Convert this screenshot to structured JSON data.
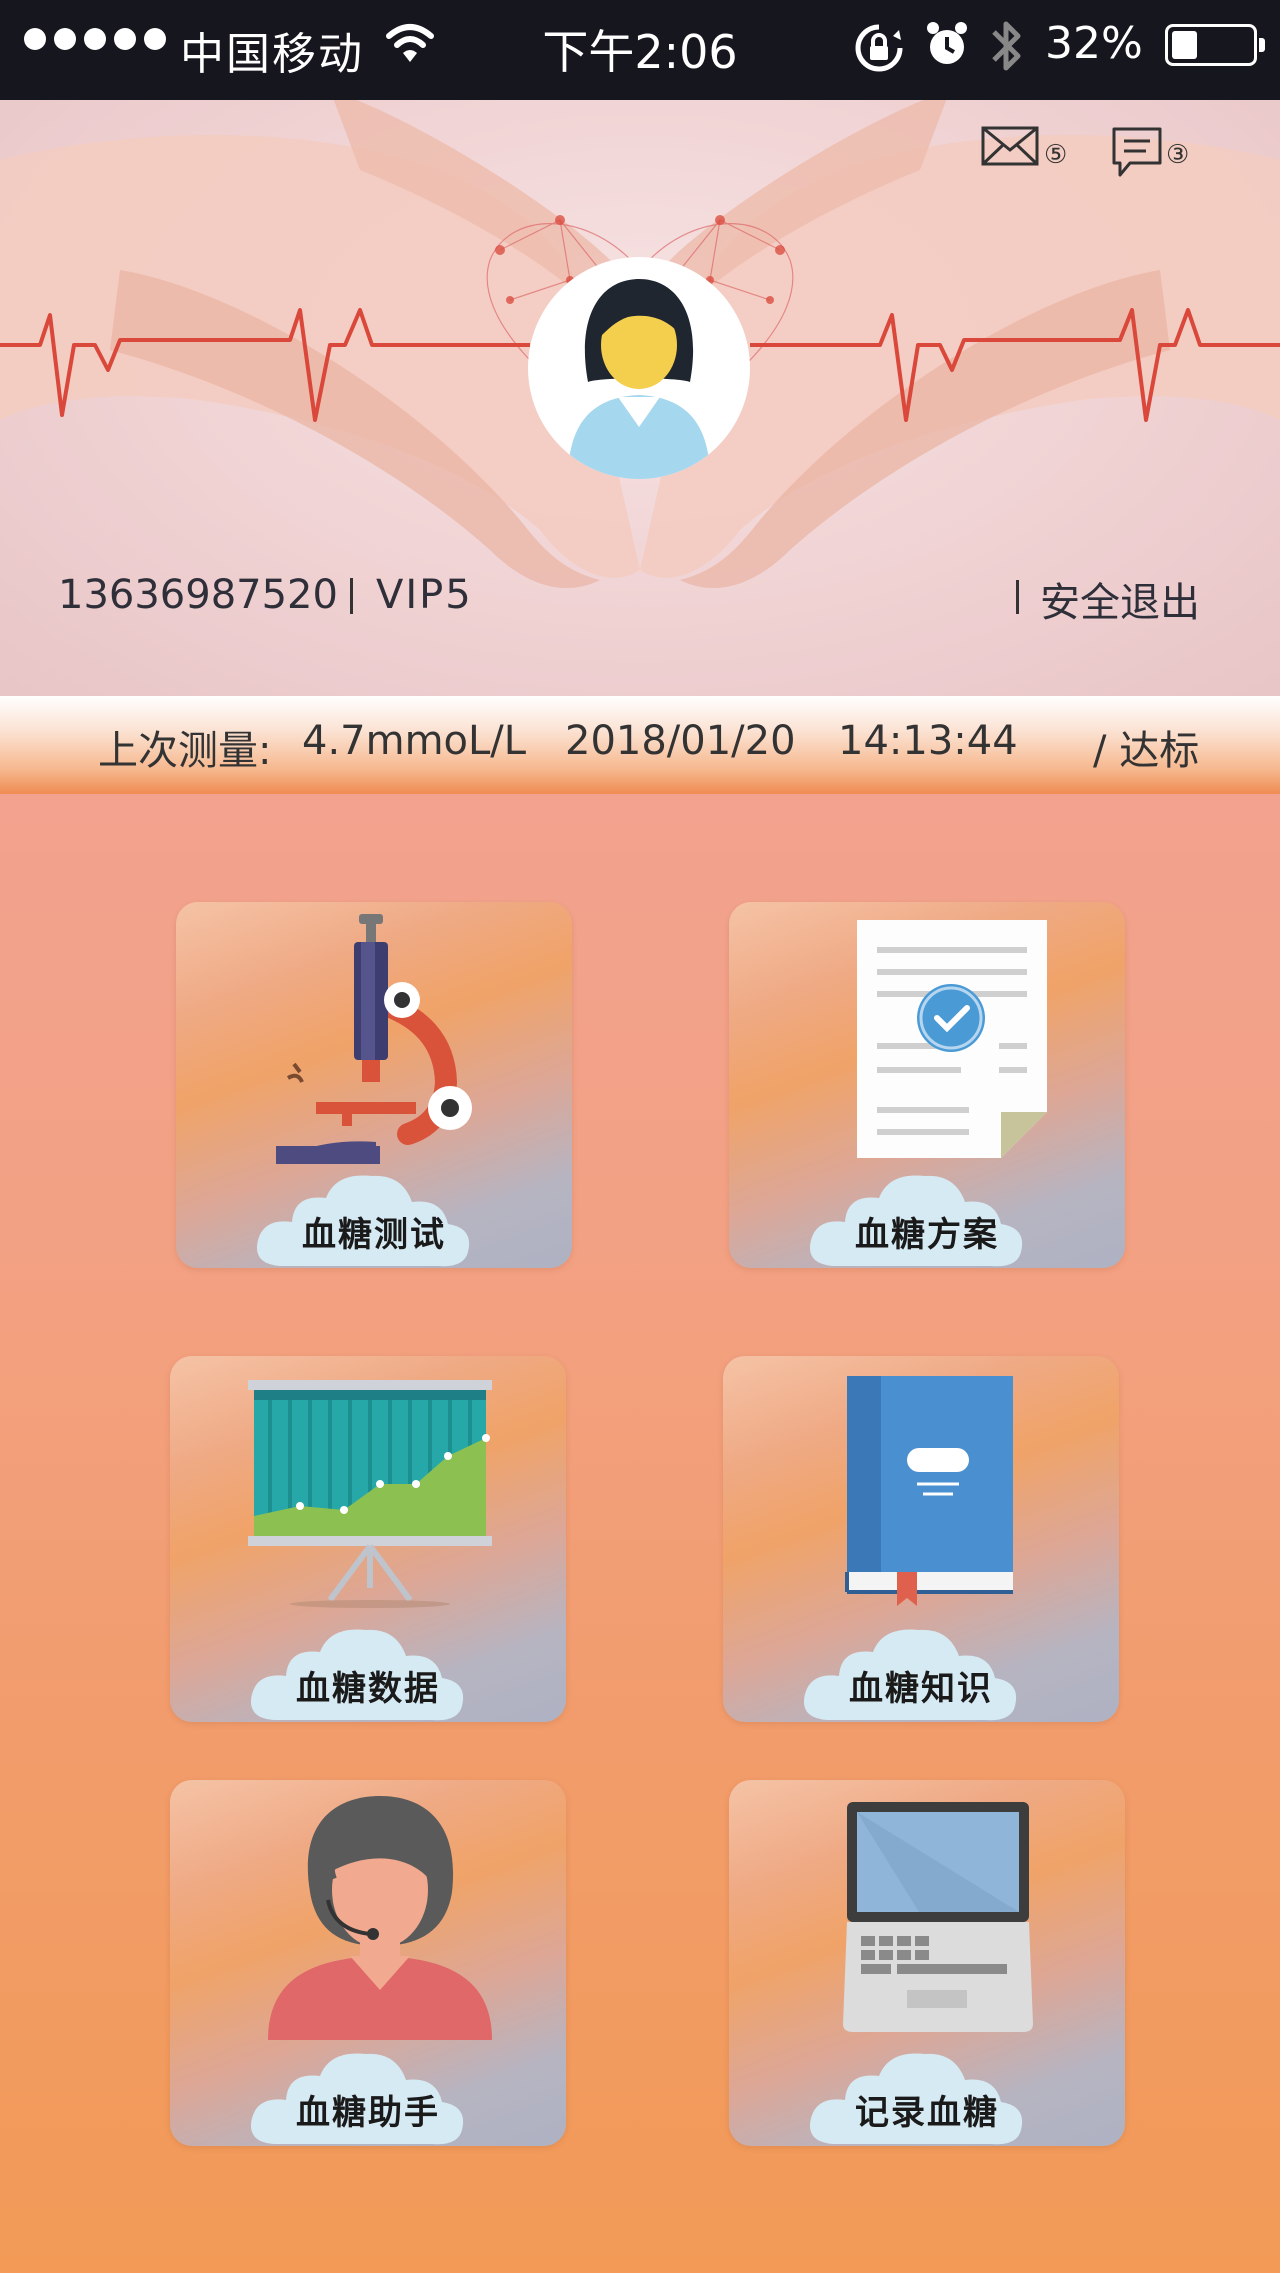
{
  "status_bar": {
    "carrier": "中国移动",
    "time": "下午2:06",
    "battery_percent": "32%",
    "battery_level": 0.32
  },
  "header": {
    "mail_badge": "⑤",
    "message_badge": "③",
    "phone": "13636987520",
    "vip_level": "VIP5",
    "logout_label": "安全退出"
  },
  "last_measure": {
    "label": "上次测量:",
    "value": "4.7mmoL/L",
    "date": "2018/01/20",
    "time": "14:13:44",
    "status": "/ 达标"
  },
  "menu": [
    {
      "label": "血糖测试",
      "icon": "microscope-icon"
    },
    {
      "label": "血糖方案",
      "icon": "document-check-icon"
    },
    {
      "label": "血糖数据",
      "icon": "chart-board-icon"
    },
    {
      "label": "血糖知识",
      "icon": "book-icon"
    },
    {
      "label": "血糖助手",
      "icon": "assistant-headset-icon"
    },
    {
      "label": "记录血糖",
      "icon": "laptop-icon"
    }
  ],
  "colors": {
    "status_bar_bg": "#16161e",
    "accent_orange": "#f29a56",
    "heartbeat_red": "#d9483b"
  }
}
